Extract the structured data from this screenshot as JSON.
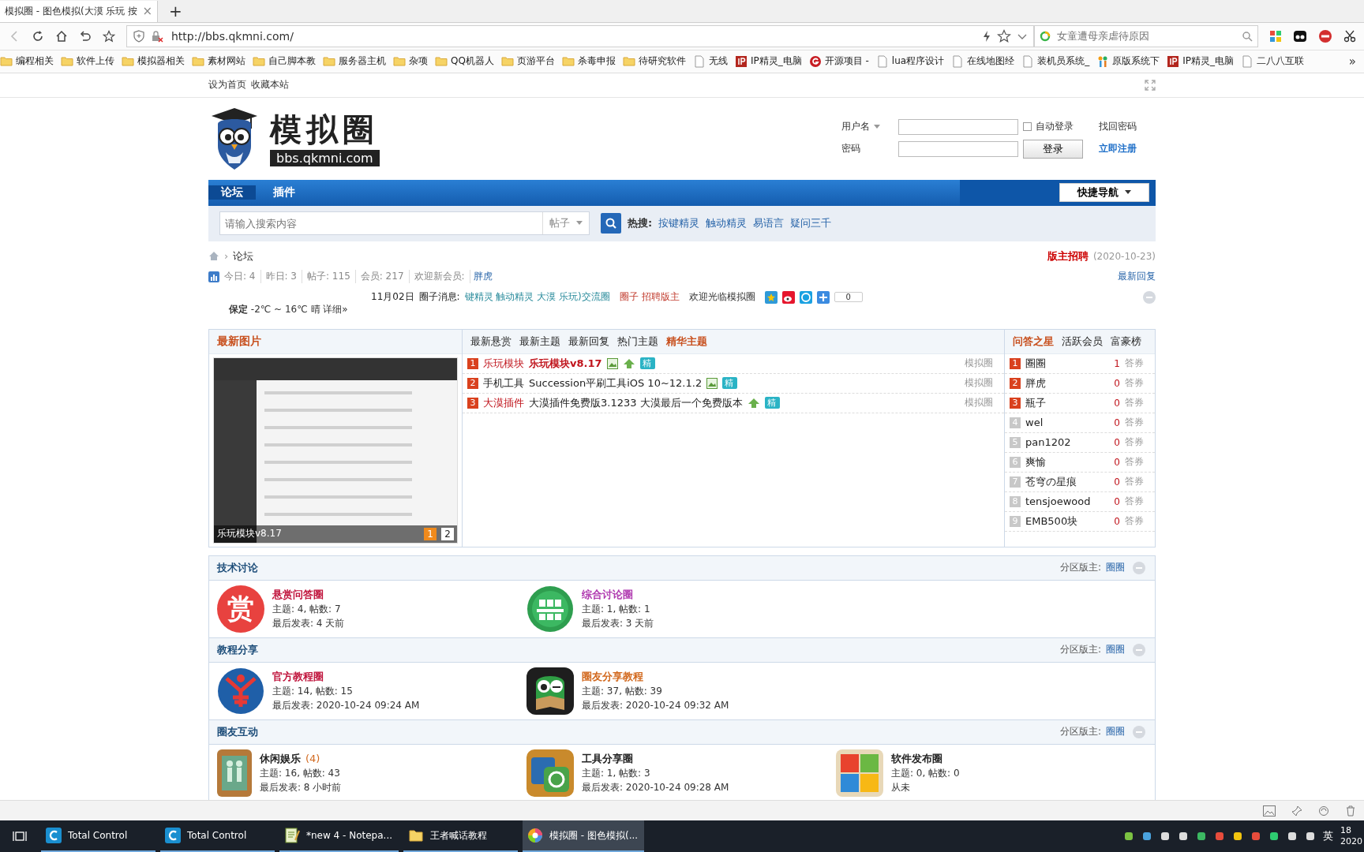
{
  "browser": {
    "tab": {
      "title": "模拟圈 - 图色模拟(大漠 乐玩 按",
      "close": "×"
    },
    "new_tab": "+",
    "url": "http://bbs.qkmni.com/",
    "search_placeholder": "女童遭母亲虐待原因",
    "bookmarks": [
      {
        "label": "编程相关",
        "kind": "folder"
      },
      {
        "label": "软件上传",
        "kind": "folder"
      },
      {
        "label": "模拟器相关",
        "kind": "folder"
      },
      {
        "label": "素材网站",
        "kind": "folder"
      },
      {
        "label": "自己脚本教",
        "kind": "folder"
      },
      {
        "label": "服务器主机",
        "kind": "folder"
      },
      {
        "label": "杂项",
        "kind": "folder"
      },
      {
        "label": "QQ机器人",
        "kind": "folder"
      },
      {
        "label": "页游平台",
        "kind": "folder"
      },
      {
        "label": "杀毒申报",
        "kind": "folder"
      },
      {
        "label": "待研究软件",
        "kind": "folder"
      },
      {
        "label": "无线",
        "kind": "page"
      },
      {
        "label": "IP精灵_电脑",
        "kind": "ip"
      },
      {
        "label": "开源项目 -",
        "kind": "g"
      },
      {
        "label": "lua程序设计",
        "kind": "page"
      },
      {
        "label": "在线地图经",
        "kind": "page"
      },
      {
        "label": "装机员系统_",
        "kind": "page"
      },
      {
        "label": "原版系统下",
        "kind": "tree"
      },
      {
        "label": "IP精灵_电脑",
        "kind": "ip"
      },
      {
        "label": "二八八互联",
        "kind": "page"
      }
    ],
    "more": "»"
  },
  "topbar": {
    "links": [
      "设为首页",
      "收藏本站"
    ]
  },
  "header": {
    "logo": {
      "title": "模拟圈",
      "domain": "bbs.qkmni.com"
    },
    "login": {
      "username_label": "用户名",
      "password_label": "密码",
      "auto_login": {
        "label": "自动登录",
        "checked": false
      },
      "forgot": "找回密码",
      "login_button": "登录",
      "register": "立即注册"
    }
  },
  "nav": {
    "items": [
      {
        "label": "论坛",
        "selected": true
      },
      {
        "label": "插件",
        "selected": false
      }
    ],
    "quick_nav": "快捷导航"
  },
  "search": {
    "placeholder": "请输入搜索内容",
    "type": "帖子",
    "hot_label": "热搜:",
    "hot": [
      "按键精灵",
      "触动精灵",
      "易语言",
      "疑问三千"
    ]
  },
  "breadcrumb": {
    "separator": "›",
    "current": "论坛"
  },
  "recruit": {
    "label": "版主招聘",
    "date": "(2020-10-23)"
  },
  "stats": {
    "items": [
      "今日: 4",
      "昨日: 3",
      "帖子: 115",
      "会员: 217"
    ],
    "welcome": "欢迎新会员:",
    "new_member": "胖虎",
    "latest_reply": "最新回复"
  },
  "news": {
    "date": "11月02日",
    "label": "圈子消息:",
    "items": [
      {
        "text": "键精灵 触动精灵 大漠 乐玩)交流圈",
        "kind": "link"
      },
      {
        "text": "圈子 招聘版主",
        "kind": "alert"
      },
      {
        "text": "欢迎光临模拟圈",
        "kind": "plain"
      }
    ],
    "share_count": "0"
  },
  "weather": "**保定** -2℃ ~ 16℃ 晴 详细»",
  "latest_images": {
    "title": "最新图片",
    "caption": "乐玩模块v8.17",
    "pages": [
      {
        "label": "1",
        "selected": true
      },
      {
        "label": "2",
        "selected": false
      }
    ]
  },
  "threads": {
    "tabs": [
      {
        "label": "最新悬赏",
        "selected": false
      },
      {
        "label": "最新主题",
        "selected": false
      },
      {
        "label": "最新回复",
        "selected": false
      },
      {
        "label": "热门主题",
        "selected": false
      },
      {
        "label": "精华主题",
        "selected": true
      }
    ],
    "rows": [
      {
        "rank": "1",
        "category": "乐玩模块",
        "category_highlight": true,
        "title": "乐玩模块v8.17",
        "title_highlight": true,
        "icons": [
          {
            "kind": "image"
          },
          {
            "kind": "up"
          },
          {
            "kind": "digest",
            "label": "精"
          }
        ],
        "forum": "模拟圈"
      },
      {
        "rank": "2",
        "category": "手机工具",
        "category_highlight": false,
        "title": "Succession平刷工具iOS 10~12.1.2",
        "title_highlight": false,
        "icons": [
          {
            "kind": "image"
          },
          {
            "kind": "digest",
            "label": "精"
          }
        ],
        "forum": "模拟圈"
      },
      {
        "rank": "3",
        "category": "大漠插件",
        "category_highlight": true,
        "title": "大漠插件免费版3.1233 大漠最后一个免费版本",
        "title_highlight": false,
        "icons": [
          {
            "kind": "up"
          },
          {
            "kind": "digest",
            "label": "精"
          }
        ],
        "forum": "模拟圈"
      }
    ]
  },
  "ranking": {
    "tabs": [
      {
        "label": "问答之星",
        "selected": true
      },
      {
        "label": "活跃会员",
        "selected": false
      },
      {
        "label": "富豪榜",
        "selected": false
      }
    ],
    "rows": [
      {
        "rank": "1",
        "name": "圈圈",
        "count": "1",
        "unit": "答券",
        "top": true
      },
      {
        "rank": "2",
        "name": "胖虎",
        "count": "0",
        "unit": "答券",
        "top": true
      },
      {
        "rank": "3",
        "name": "瓶子",
        "count": "0",
        "unit": "答券",
        "top": true
      },
      {
        "rank": "4",
        "name": "wel",
        "count": "0",
        "unit": "答券",
        "top": false
      },
      {
        "rank": "5",
        "name": "pan1202",
        "count": "0",
        "unit": "答券",
        "top": false
      },
      {
        "rank": "6",
        "name": "爽愉",
        "count": "0",
        "unit": "答券",
        "top": false
      },
      {
        "rank": "7",
        "name": "苍穹の星痕",
        "count": "0",
        "unit": "答券",
        "top": false
      },
      {
        "rank": "8",
        "name": "tensjoewood",
        "count": "0",
        "unit": "答券",
        "top": false
      },
      {
        "rank": "9",
        "name": "EMB500块",
        "count": "0",
        "unit": "答券",
        "top": false
      }
    ]
  },
  "categories": [
    {
      "title": "技术讨论",
      "moderator_label": "分区版主:",
      "moderator": "圈圈",
      "forums": [
        {
          "name": "悬赏问答圈",
          "color": "#c0143c",
          "kind": "reward",
          "icon_text": "赏",
          "stats": "主题: 4, 帖数: 7",
          "last": "最后发表: 4 天前"
        },
        {
          "name": "综合讨论圈",
          "color": "#b03ab0",
          "kind": "group",
          "stats": "主题: 1, 帖数: 1",
          "last": "最后发表: 3 天前"
        }
      ]
    },
    {
      "title": "教程分享",
      "moderator_label": "分区版主:",
      "moderator": "圈圈",
      "forums": [
        {
          "name": "官方教程圈",
          "color": "#c0143c",
          "kind": "official",
          "stats": "主题: 14, 帖数: 15",
          "last": "最后发表: 2020-10-24 09:24 AM"
        },
        {
          "name": "圈友分享教程",
          "color": "#d2691e",
          "kind": "owl",
          "stats": "主题: 37, 帖数: 39",
          "last": "最后发表: 2020-10-24 09:32 AM"
        }
      ]
    },
    {
      "title": "圈友互动",
      "moderator_label": "分区版主:",
      "moderator": "圈圈",
      "forums": [
        {
          "name": "休闲娱乐",
          "color": "#222222",
          "today": "(4)",
          "kind": "leisure",
          "stats": "主题: 16, 帖数: 43",
          "last": "最后发表: 8 小时前"
        },
        {
          "name": "工具分享圈",
          "color": "#222222",
          "kind": "tools",
          "stats": "主题: 1, 帖数: 3",
          "last": "最后发表: 2020-10-24 09:28 AM"
        },
        {
          "name": "软件发布圈",
          "color": "#222222",
          "kind": "windows",
          "stats": "主题: 0, 帖数: 0",
          "last": "从未"
        }
      ]
    }
  ],
  "taskbar": {
    "items": [
      {
        "label": "Total Control",
        "kind": "tc",
        "selected": false
      },
      {
        "label": "Total Control",
        "kind": "tc",
        "selected": false
      },
      {
        "label": "*new 4 - Notepa...",
        "kind": "notepad",
        "selected": false
      },
      {
        "label": "王者喊话教程",
        "kind": "folder",
        "selected": false
      },
      {
        "label": "模拟圈 - 图色模拟(...",
        "kind": "browser",
        "selected": true
      }
    ],
    "ime": "英",
    "clock": [
      "18",
      "2020"
    ]
  }
}
